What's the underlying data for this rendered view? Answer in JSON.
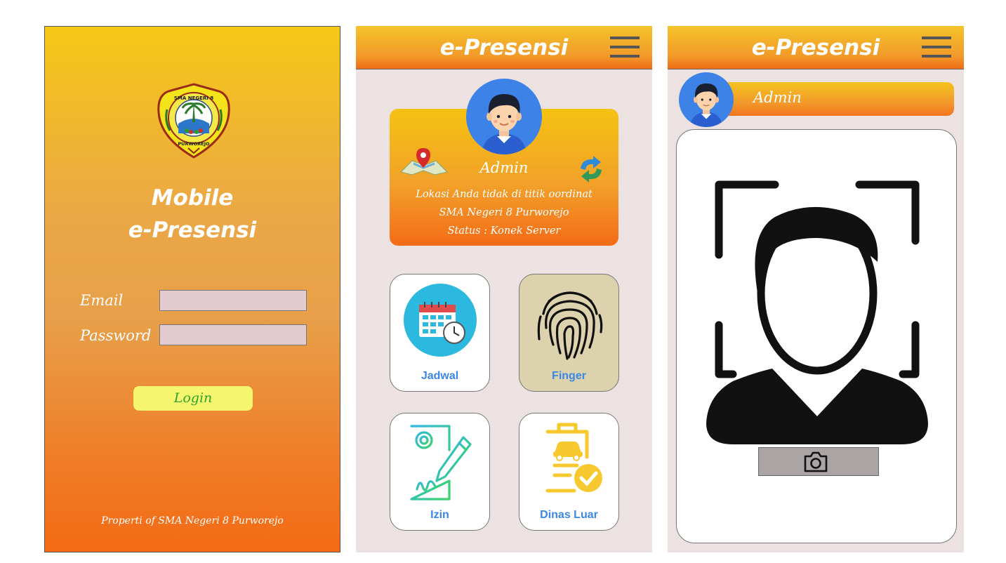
{
  "login": {
    "logo_text_top": "SMA NEGERI 8",
    "logo_text_bottom": "PURWOREJO",
    "title_line1": "Mobile",
    "title_line2": "e-Presensi",
    "email_label": "Email",
    "email_value": "",
    "password_label": "Password",
    "password_value": "",
    "login_button": "Login",
    "footer": "Properti of SMA Negeri 8 Purworejo"
  },
  "dashboard": {
    "header_title": "e-Presensi",
    "user_name": "Admin",
    "location_status": "Lokasi Anda tidak di titik oordinat",
    "school_name": "SMA Negeri 8 Purworejo",
    "server_status": "Status : Konek Server",
    "tiles": [
      {
        "label": "Jadwal",
        "icon": "calendar-clock-icon"
      },
      {
        "label": "Finger",
        "icon": "fingerprint-icon"
      },
      {
        "label": "Izin",
        "icon": "permit-document-pen-icon"
      },
      {
        "label": "Dinas Luar",
        "icon": "clipboard-car-check-icon"
      }
    ]
  },
  "camera": {
    "header_title": "e-Presensi",
    "user_name": "Admin",
    "capture_icon": "camera-icon"
  },
  "colors": {
    "header_top": "#f4c32a",
    "header_bottom": "#ee6d18",
    "tile_label": "#3b86e6",
    "login_button_bg": "#f5f56e",
    "login_button_text": "#2fa32f"
  }
}
